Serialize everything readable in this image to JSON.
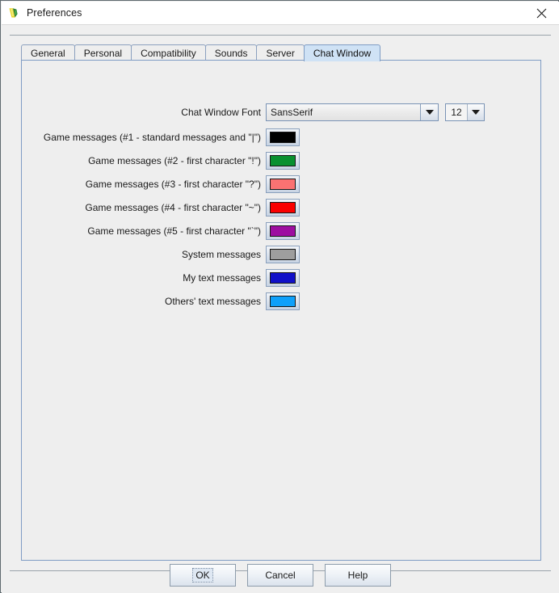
{
  "window": {
    "title": "Preferences",
    "app_icon": "app-leaf-icon",
    "close_icon": "close-icon"
  },
  "tabs": [
    {
      "label": "General",
      "selected": false
    },
    {
      "label": "Personal",
      "selected": false
    },
    {
      "label": "Compatibility",
      "selected": false
    },
    {
      "label": "Sounds",
      "selected": false
    },
    {
      "label": "Server",
      "selected": false
    },
    {
      "label": "Chat Window",
      "selected": true
    }
  ],
  "font_row": {
    "label": "Chat Window Font",
    "family_value": "SansSerif",
    "size_value": "12",
    "dropdown_icon": "chevron-down-icon"
  },
  "color_rows": [
    {
      "label": "Game messages (#1 - standard messages and \"|\")",
      "color": "#000000"
    },
    {
      "label": "Game messages (#2 - first character \"!\")",
      "color": "#089030"
    },
    {
      "label": "Game messages (#3 - first character \"?\")",
      "color": "#fa7272"
    },
    {
      "label": "Game messages (#4 - first character \"~\")",
      "color": "#fa0000"
    },
    {
      "label": "Game messages (#5 - first character \"`\")",
      "color": "#9d0ea0"
    },
    {
      "label": "System messages",
      "color": "#9e9e9e"
    },
    {
      "label": "My text messages",
      "color": "#1010c8"
    },
    {
      "label": "Others' text messages",
      "color": "#0ea0fa"
    }
  ],
  "buttons": {
    "ok": "OK",
    "cancel": "Cancel",
    "help": "Help"
  }
}
